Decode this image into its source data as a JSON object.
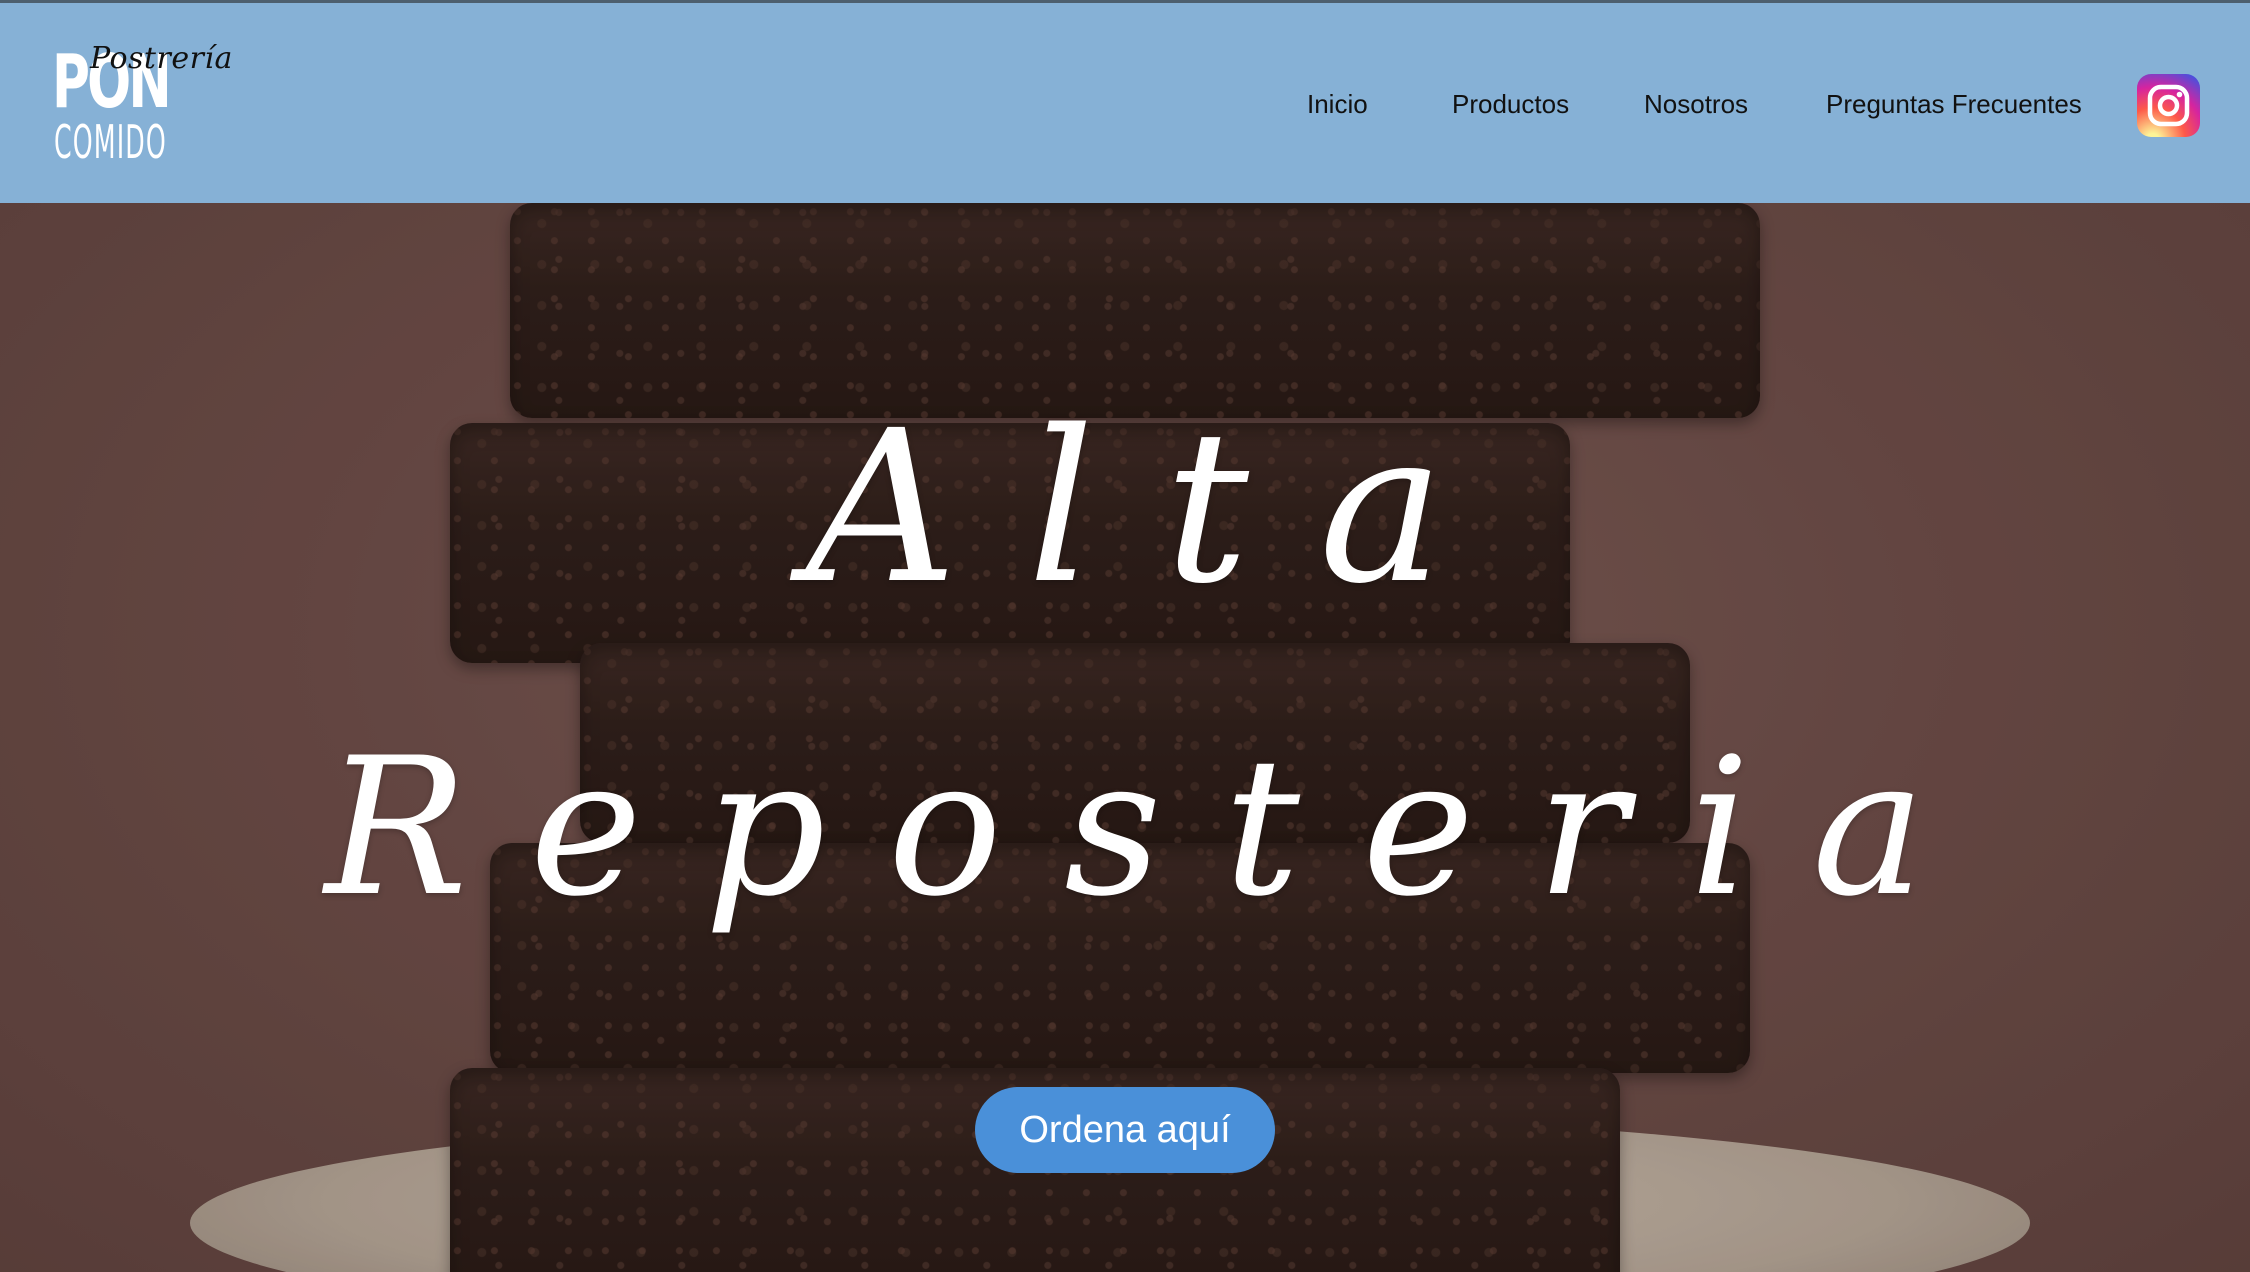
{
  "header": {
    "background_color": "#86b1d6",
    "logo": {
      "script_text": "Postrería",
      "word_text": "PON",
      "sub_text": "COMIDO"
    },
    "nav": {
      "items": [
        {
          "label": "Inicio"
        },
        {
          "label": "Productos"
        },
        {
          "label": "Nosotros"
        },
        {
          "label": "Preguntas Frecuentes"
        }
      ]
    },
    "social": {
      "icon": "instagram-icon"
    }
  },
  "hero": {
    "headline_line1": "Alta",
    "headline_line2": "Reposteria",
    "cta_label": "Ordena aquí",
    "cta_color": "#4a90d9"
  }
}
